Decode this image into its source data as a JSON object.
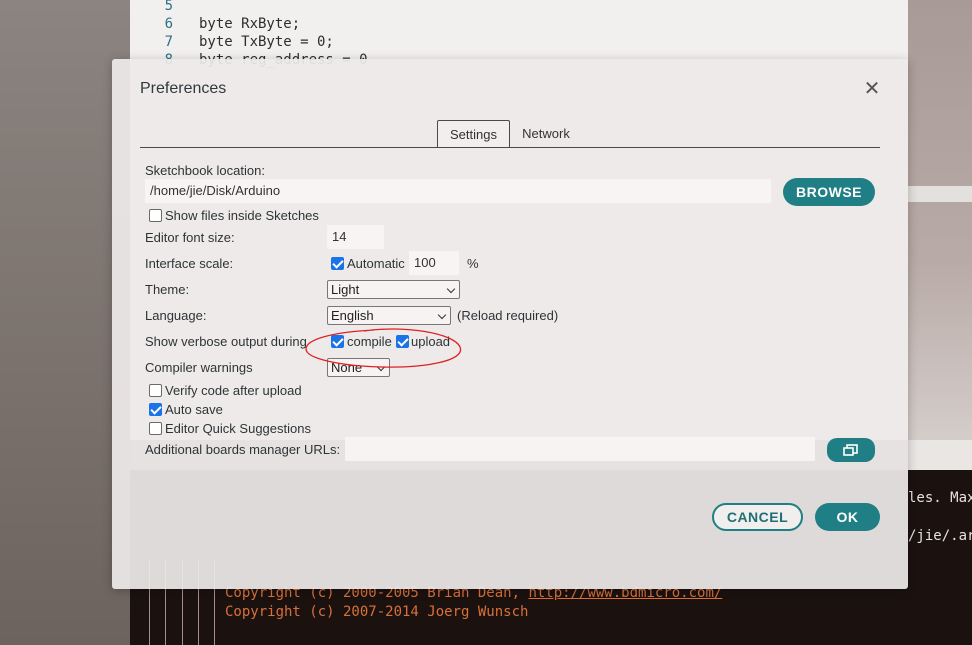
{
  "editor": {
    "line_numbers": [
      "5",
      "6",
      "7",
      "8"
    ],
    "code_lines": [
      "",
      "byte RxByte;",
      "byte TxByte = 0;",
      "byte reg_address = 0"
    ]
  },
  "console": {
    "lines": [
      {
        "prefix": "Copyright (c) 2000-2005 Brian Dean, ",
        "link": "http://www.bdmicro.com/"
      },
      {
        "prefix": "Copyright (c) 2007-2014 Joerg Wunsch",
        "link": ""
      }
    ],
    "right_fragments": [
      "les. Max",
      "/jie/.ar"
    ]
  },
  "dialog": {
    "title": "Preferences",
    "close_icon": "close-icon",
    "tabs": [
      {
        "label": "Settings",
        "active": true
      },
      {
        "label": "Network",
        "active": false
      }
    ],
    "sketchbook": {
      "label": "Sketchbook location:",
      "value": "/home/jie/Disk/Arduino",
      "browse_label": "BROWSE"
    },
    "show_files": {
      "label": "Show files inside Sketches",
      "checked": false
    },
    "font_size": {
      "label": "Editor font size:",
      "value": "14"
    },
    "interface_scale": {
      "label": "Interface scale:",
      "automatic_label": "Automatic",
      "automatic_checked": true,
      "value": "100",
      "unit": "%"
    },
    "theme": {
      "label": "Theme:",
      "value": "Light"
    },
    "language": {
      "label": "Language:",
      "value": "English",
      "note": "(Reload required)"
    },
    "verbose": {
      "label": "Show verbose output during",
      "compile_label": "compile",
      "compile_checked": true,
      "upload_label": "upload",
      "upload_checked": true
    },
    "compiler_warnings": {
      "label": "Compiler warnings",
      "value": "None"
    },
    "verify": {
      "label": "Verify code after upload",
      "checked": false
    },
    "auto_save": {
      "label": "Auto save",
      "checked": true
    },
    "quick_suggestions": {
      "label": "Editor Quick Suggestions",
      "checked": false
    },
    "boards_urls": {
      "label": "Additional boards manager URLs:",
      "value": "",
      "button_icon": "open-window-icon"
    },
    "cancel_label": "CANCEL",
    "ok_label": "OK"
  },
  "colors": {
    "accent": "#1f7f84",
    "checkbox": "#1a73e8",
    "annotation": "#e02020"
  }
}
